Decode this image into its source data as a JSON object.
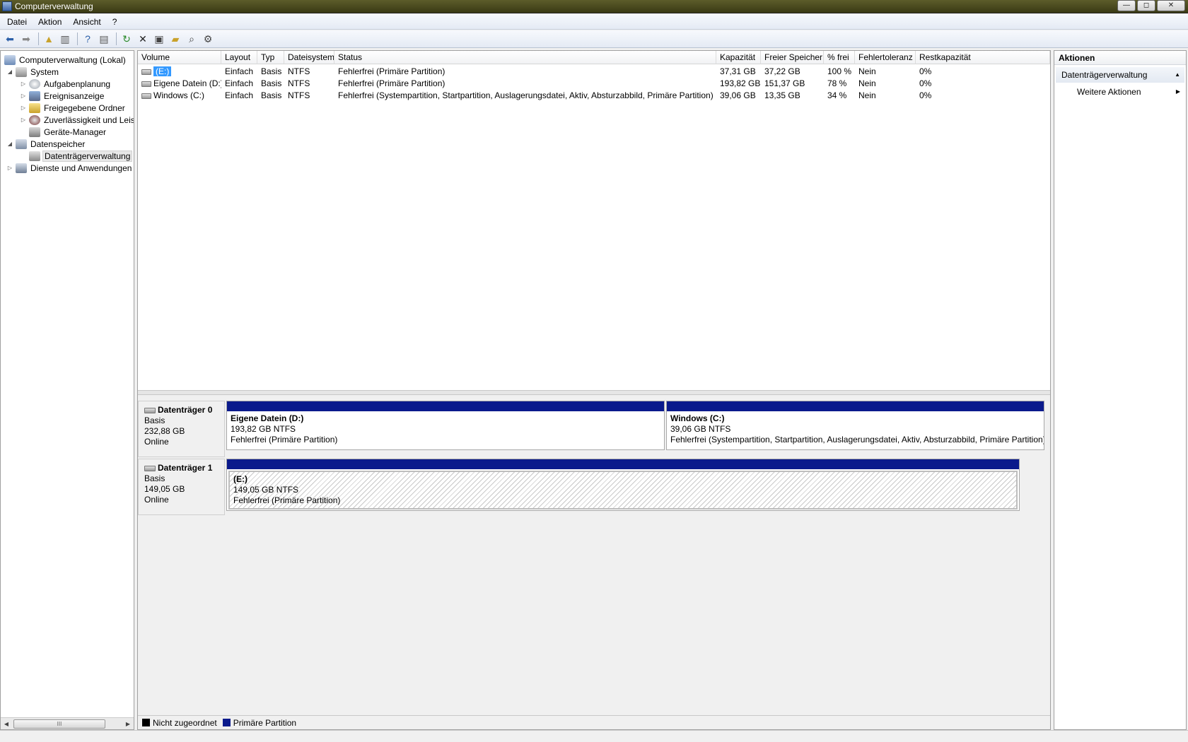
{
  "window": {
    "title": "Computerverwaltung",
    "minimize": "—",
    "maximize": "◻",
    "close": "✕"
  },
  "menu": [
    "Datei",
    "Aktion",
    "Ansicht",
    "?"
  ],
  "tree": {
    "root": "Computerverwaltung (Lokal)",
    "system": "System",
    "aufgabenplanung": "Aufgabenplanung",
    "ereignisanzeige": "Ereignisanzeige",
    "freigegebene": "Freigegebene Ordner",
    "zuverlaessigkeit": "Zuverlässigkeit und Leis",
    "geraete": "Geräte-Manager",
    "datenspeicher": "Datenspeicher",
    "datentraeger": "Datenträgerverwaltung",
    "dienste": "Dienste und Anwendungen"
  },
  "columns": [
    "Volume",
    "Layout",
    "Typ",
    "Dateisystem",
    "Status",
    "Kapazität",
    "Freier Speicher",
    "% frei",
    "Fehlertoleranz",
    "Restkapazität"
  ],
  "volumes": [
    {
      "volume": "(E:)",
      "layout": "Einfach",
      "typ": "Basis",
      "fs": "NTFS",
      "status": "Fehlerfrei (Primäre Partition)",
      "kap": "37,31 GB",
      "frei": "37,22 GB",
      "pct": "100 %",
      "ft": "Nein",
      "rest": "0%"
    },
    {
      "volume": "Eigene Datein (D:)",
      "layout": "Einfach",
      "typ": "Basis",
      "fs": "NTFS",
      "status": "Fehlerfrei (Primäre Partition)",
      "kap": "193,82 GB",
      "frei": "151,37 GB",
      "pct": "78 %",
      "ft": "Nein",
      "rest": "0%"
    },
    {
      "volume": "Windows (C:)",
      "layout": "Einfach",
      "typ": "Basis",
      "fs": "NTFS",
      "status": "Fehlerfrei (Systempartition, Startpartition, Auslagerungsdatei, Aktiv, Absturzabbild, Primäre Partition)",
      "kap": "39,06 GB",
      "frei": "13,35 GB",
      "pct": "34 %",
      "ft": "Nein",
      "rest": "0%"
    }
  ],
  "disks": [
    {
      "name": "Datenträger 0",
      "type": "Basis",
      "size": "232,88 GB",
      "state": "Online",
      "parts": [
        {
          "name": "Eigene Datein  (D:)",
          "size": "193,82 GB NTFS",
          "status": "Fehlerfrei (Primäre Partition)"
        },
        {
          "name": "Windows  (C:)",
          "size": "39,06 GB NTFS",
          "status": "Fehlerfrei (Systempartition, Startpartition, Auslagerungsdatei, Aktiv, Absturzabbild, Primäre Partition)"
        }
      ]
    },
    {
      "name": "Datenträger 1",
      "type": "Basis",
      "size": "149,05 GB",
      "state": "Online",
      "parts": [
        {
          "name": "(E:)",
          "size": "149,05 GB NTFS",
          "status": "Fehlerfrei (Primäre Partition)"
        }
      ]
    }
  ],
  "legend": [
    {
      "label": "Nicht zugeordnet",
      "color": "#000000"
    },
    {
      "label": "Primäre Partition",
      "color": "#0a1a8c"
    }
  ],
  "actions": {
    "title": "Aktionen",
    "section": "Datenträgerverwaltung",
    "more": "Weitere Aktionen"
  },
  "scroll": {
    "thumb": "III"
  }
}
